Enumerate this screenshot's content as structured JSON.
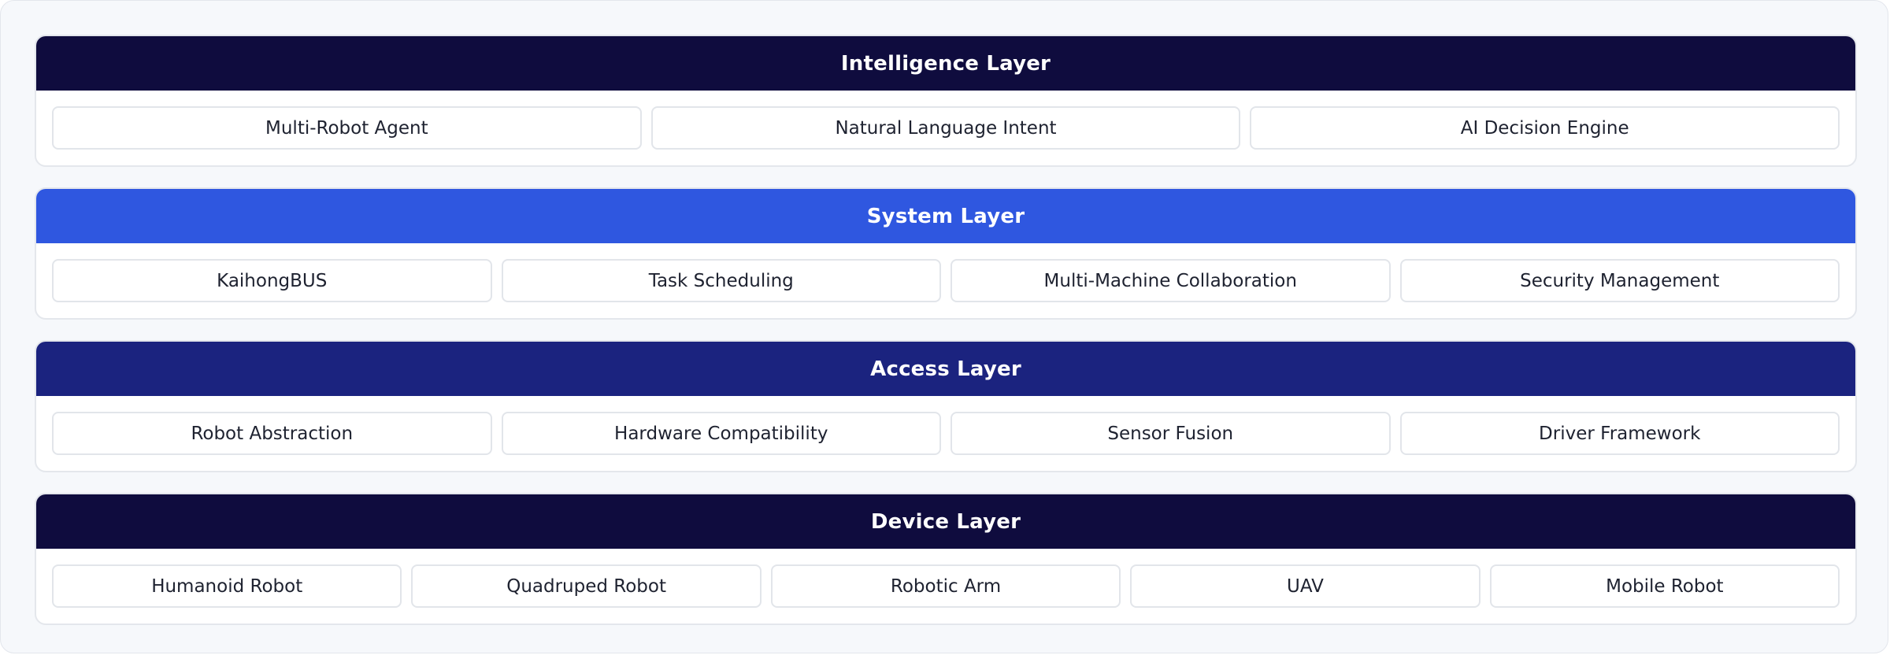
{
  "colors": {
    "intelligence": "#0f0c3e",
    "system": "#2f57e0",
    "access": "#1b237f",
    "device": "#0f0c3e"
  },
  "layers": [
    {
      "title": "Intelligence Layer",
      "items": [
        "Multi-Robot Agent",
        "Natural Language Intent",
        "AI Decision Engine"
      ]
    },
    {
      "title": "System Layer",
      "items": [
        "KaihongBUS",
        "Task Scheduling",
        "Multi-Machine Collaboration",
        "Security Management"
      ]
    },
    {
      "title": "Access Layer",
      "items": [
        "Robot Abstraction",
        "Hardware Compatibility",
        "Sensor Fusion",
        "Driver Framework"
      ]
    },
    {
      "title": "Device Layer",
      "items": [
        "Humanoid Robot",
        "Quadruped Robot",
        "Robotic Arm",
        "UAV",
        "Mobile Robot"
      ]
    }
  ]
}
